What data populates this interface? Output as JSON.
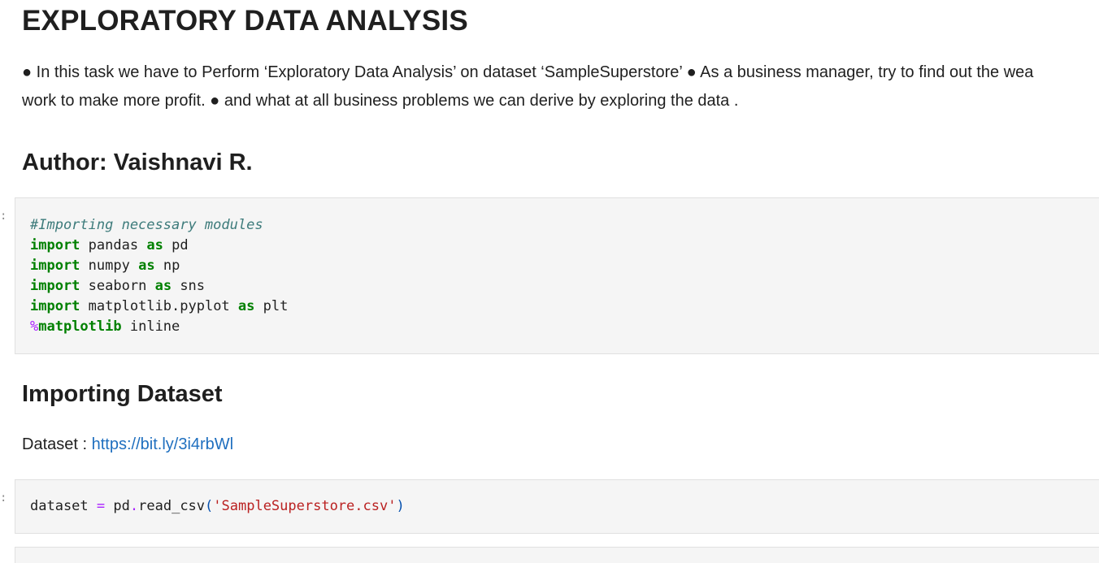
{
  "heading": {
    "title": "EXPLORATORY DATA ANALYSIS"
  },
  "intro": {
    "line1": "● In this task we have to Perform ‘Exploratory Data Analysis’ on dataset ‘SampleSuperstore’ ● As a business manager, try to find out the wea",
    "line2": "work to make more profit. ● and what at all business problems we can derive by exploring the data ."
  },
  "author": {
    "heading": "Author: Vaishnavi R."
  },
  "cell1": {
    "marker": ":",
    "comment": "#Importing necessary modules",
    "kw_import": "import",
    "kw_as": "as",
    "lines": [
      {
        "module": "pandas",
        "alias": "pd"
      },
      {
        "module": "numpy",
        "alias": "np"
      },
      {
        "module": "seaborn",
        "alias": "sns"
      },
      {
        "module": "matplotlib.pyplot",
        "alias": "plt"
      }
    ],
    "magic_percent": "%",
    "magic_name": "matplotlib",
    "magic_arg": "inline"
  },
  "dataset_section": {
    "heading": "Importing Dataset",
    "label": "Dataset : ",
    "link": "https://bit.ly/3i4rbWl"
  },
  "cell2": {
    "marker": ":",
    "var": "dataset",
    "eq": "=",
    "obj": "pd",
    "dot": ".",
    "func": "read_csv",
    "open_paren": "(",
    "arg": "'SampleSuperstore.csv'",
    "close_paren": ")"
  },
  "colors": {
    "keyword": "#008000",
    "comment": "#3d7b7b",
    "magic": "#aa22ff",
    "string": "#ba2121",
    "link": "#1f6fbf",
    "cell_bg": "#f5f5f5"
  }
}
